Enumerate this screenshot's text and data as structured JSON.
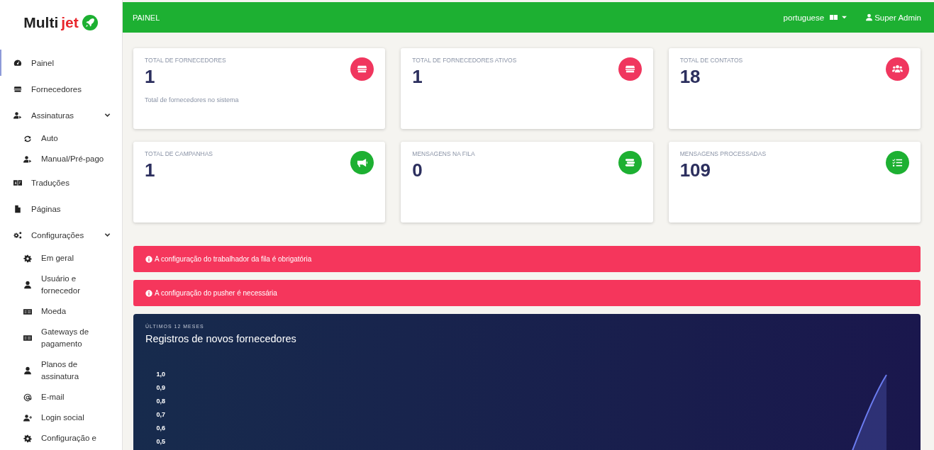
{
  "sidebar": {
    "logo": {
      "word1": "Multi",
      "word2": "jet"
    },
    "items": [
      {
        "label": "Painel",
        "selected": true
      },
      {
        "label": "Fornecedores",
        "selected": false
      },
      {
        "label": "Assinaturas",
        "selected": false,
        "expanded": true,
        "children": [
          {
            "label": "Auto",
            "selected": false
          },
          {
            "label": "Manual/Pré-pago",
            "selected": false
          }
        ]
      },
      {
        "label": "Traduções",
        "selected": false
      },
      {
        "label": "Páginas",
        "selected": false
      },
      {
        "label": "Configurações",
        "selected": false,
        "expanded": true,
        "children": [
          {
            "label": "Em geral",
            "selected": false
          },
          {
            "label": "Usuário e fornecedor",
            "selected": false
          },
          {
            "label": "Moeda",
            "selected": false
          },
          {
            "label": "Gateways de pagamento",
            "selected": false
          },
          {
            "label": "Planos de assinatura",
            "selected": false
          },
          {
            "label": "E-mail",
            "selected": false
          },
          {
            "label": "Login social",
            "selected": false
          },
          {
            "label": "Configuração e",
            "selected": false
          }
        ]
      }
    ]
  },
  "topbar": {
    "title": "PAINEL",
    "language": "portuguese",
    "user": "Super Admin"
  },
  "stats": [
    {
      "label": "TOTAL DE FORNECEDORES",
      "value": "1",
      "note": "Total de fornecedores no sistema",
      "color": "#f0365e"
    },
    {
      "label": "TOTAL DE FORNECEDORES ATIVOS",
      "value": "1",
      "color": "#f0365e"
    },
    {
      "label": "TOTAL DE CONTATOS",
      "value": "18",
      "color": "#f0365e"
    },
    {
      "label": "TOTAL DE CAMPANHAS",
      "value": "1",
      "color": "#1db032"
    },
    {
      "label": "MENSAGENS NA FILA",
      "value": "0",
      "color": "#1db032"
    },
    {
      "label": "MENSAGENS PROCESSADAS",
      "value": "109",
      "color": "#1db032"
    }
  ],
  "alerts": [
    {
      "text": "A configuração do trabalhador da fila é obrigatória"
    },
    {
      "text": "A configuração do pusher é necessária"
    }
  ],
  "chart": {
    "eyebrow": "ÚLTIMOS 12 MESES",
    "title": "Registros de novos fornecedores",
    "axis_labels": [
      "1,0",
      "0,9",
      "0,8",
      "0,7",
      "0,6",
      "0,5"
    ]
  }
}
